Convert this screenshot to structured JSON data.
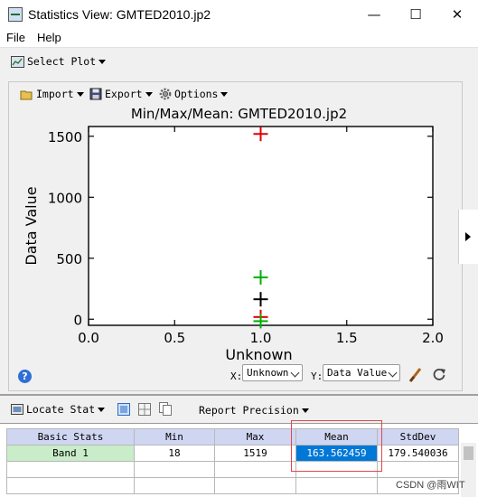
{
  "window": {
    "title": "Statistics View: GMTED2010.jp2",
    "minimize_glyph": "—",
    "maximize_glyph": "☐",
    "close_glyph": "✕",
    "app_icon": "statistics-window-icon"
  },
  "menubar": {
    "items": [
      "File",
      "Help"
    ]
  },
  "toolbar": {
    "select_plot_label": "Select Plot",
    "select_plot_icon": "plot-icon"
  },
  "plot_toolbar": {
    "import_label": "Import",
    "export_label": "Export",
    "options_label": "Options",
    "import_icon": "folder-open-icon",
    "export_icon": "floppy-disk-icon",
    "options_icon": "gear-icon"
  },
  "chart_data": {
    "type": "scatter",
    "title": "Min/Max/Mean: GMTED2010.jp2",
    "xlabel": "Unknown",
    "ylabel": "Data Value",
    "xlim": [
      0.0,
      2.0
    ],
    "ylim": [
      -50,
      1580
    ],
    "x_ticks": [
      "0.0",
      "0.5",
      "1.0",
      "1.5",
      "2.0"
    ],
    "y_ticks": [
      {
        "label": "0",
        "value": 0
      },
      {
        "label": "500",
        "value": 500
      },
      {
        "label": "1000",
        "value": 1000
      },
      {
        "label": "1500",
        "value": 1500
      }
    ],
    "grid": false,
    "points": [
      {
        "x": 1.0,
        "y": 1519,
        "color": "#e00000"
      },
      {
        "x": 1.0,
        "y": 343.1,
        "color": "#00b000"
      },
      {
        "x": 1.0,
        "y": 163.56,
        "color": "#000000"
      },
      {
        "x": 1.0,
        "y": 18,
        "color": "#e00000"
      },
      {
        "x": 1.0,
        "y": -16,
        "color": "#00b000"
      }
    ]
  },
  "axis_controls": {
    "x_label": "X:",
    "x_value": "Unknown",
    "y_label": "Y:",
    "y_value": "Data Value",
    "help_icon": "help-icon",
    "brush_icon": "paintbrush-icon",
    "refresh_icon": "refresh-icon"
  },
  "stats_toolbar": {
    "locate_label": "Locate Stat",
    "locate_icon": "locate-icon",
    "report_label": "Report Precision",
    "view_icons": [
      "single-view-icon",
      "grid-view-icon",
      "copy-icon"
    ]
  },
  "stats_table": {
    "headers": [
      "Basic Stats",
      "Min",
      "Max",
      "Mean",
      "StdDev"
    ],
    "rows": [
      [
        "Band 1",
        "18",
        "1519",
        "163.562459",
        "179.540036"
      ]
    ]
  },
  "watermark": "CSDN @雨WIT"
}
